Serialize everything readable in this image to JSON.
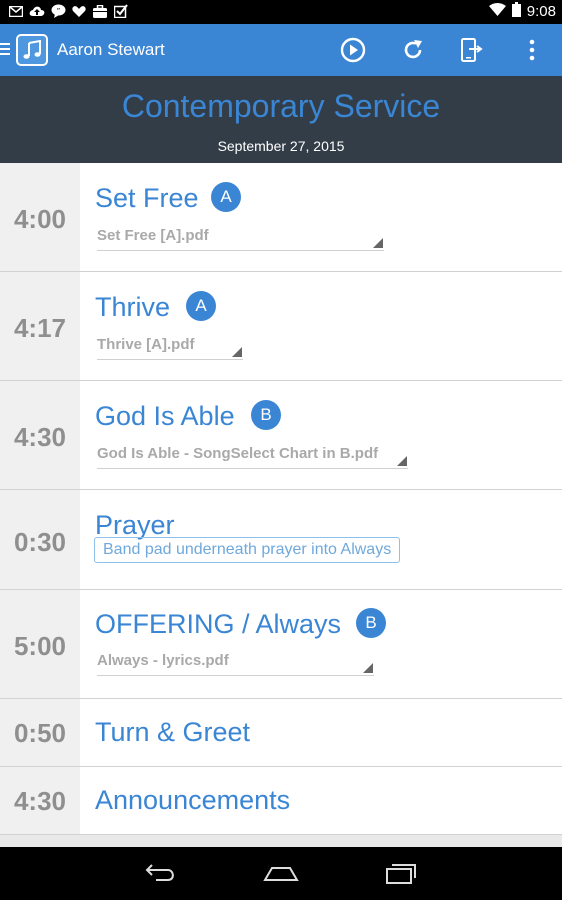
{
  "status_bar": {
    "time": "9:08",
    "left_icons": [
      "gmail-icon",
      "upload-cloud-icon",
      "chat-bubble-icon",
      "heart-icon",
      "briefcase-icon",
      "checkbox-icon"
    ],
    "right_icons": [
      "wifi-icon",
      "battery-icon"
    ]
  },
  "app_bar": {
    "title": "Aaron Stewart",
    "accent_color": "#3a86d4",
    "actions": [
      "play-icon",
      "refresh-icon",
      "export-icon",
      "more-vert-icon"
    ]
  },
  "header": {
    "title": "Contemporary Service",
    "date": "September 27, 2015",
    "background": "#333d48"
  },
  "items": [
    {
      "time": "4:00",
      "title": "Set Free",
      "key": "A",
      "file": "Set Free [A].pdf"
    },
    {
      "time": "4:17",
      "title": "Thrive",
      "key": "A",
      "file": "Thrive [A].pdf"
    },
    {
      "time": "4:30",
      "title": "God Is Able",
      "key": "B",
      "file": "God Is Able - SongSelect Chart in B.pdf"
    },
    {
      "time": "0:30",
      "title": "Prayer",
      "note": "Band pad underneath prayer into Always"
    },
    {
      "time": "5:00",
      "title": "OFFERING / Always",
      "key": "B",
      "file": "Always - lyrics.pdf"
    },
    {
      "time": "0:50",
      "title": "Turn & Greet"
    },
    {
      "time": "4:30",
      "title": "Announcements"
    }
  ],
  "nav_bar": {
    "buttons": [
      "back-icon",
      "home-icon",
      "recents-icon"
    ]
  }
}
